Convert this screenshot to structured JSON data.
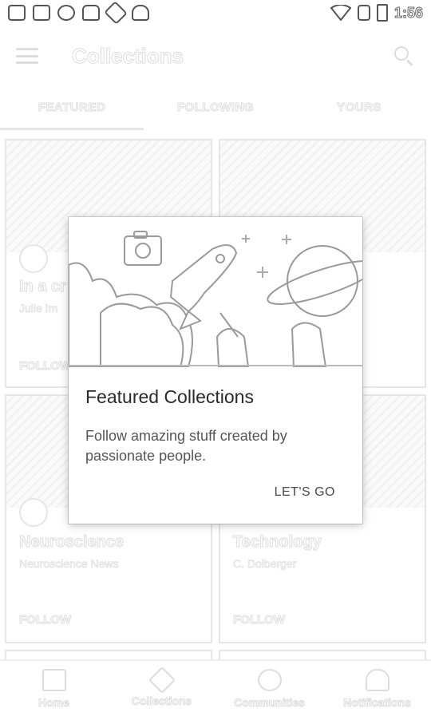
{
  "status_bar": {
    "time": "1:56",
    "icons": [
      "gallery-icon",
      "message-icon",
      "sync-icon",
      "lock-icon",
      "wrench-icon",
      "android-icon"
    ],
    "right_icons": [
      "wifi-icon",
      "no-sim-icon",
      "battery-icon"
    ]
  },
  "app_bar": {
    "title": "Collections",
    "menu_icon": "menu-icon",
    "search_icon": "search-icon"
  },
  "tabs": [
    {
      "label": "FEATURED"
    },
    {
      "label": "FOLLOWING"
    },
    {
      "label": "YOURS"
    }
  ],
  "cards": [
    {
      "title": "In a cr",
      "subtitle": "Julie Im",
      "follow": "FOLLOW"
    },
    {
      "title": "",
      "subtitle": "",
      "follow": ""
    },
    {
      "title": "Neuroscience",
      "subtitle": "Neuroscience News",
      "follow": "FOLLOW"
    },
    {
      "title": "Technology",
      "subtitle": "C. Dolberger",
      "follow": "FOLLOW"
    }
  ],
  "dialog": {
    "title": "Featured Collections",
    "body": "Follow amazing stuff created by passionate people.",
    "action": "LET'S GO",
    "illustration_icons": [
      "camera-icon",
      "rocket-icon",
      "planet-icon",
      "character-icon"
    ]
  },
  "bottom_nav": [
    {
      "label": "Home",
      "icon": "home-icon"
    },
    {
      "label": "Collections",
      "icon": "collections-icon"
    },
    {
      "label": "Communities",
      "icon": "communities-icon"
    },
    {
      "label": "Notifications",
      "icon": "bell-icon"
    }
  ]
}
